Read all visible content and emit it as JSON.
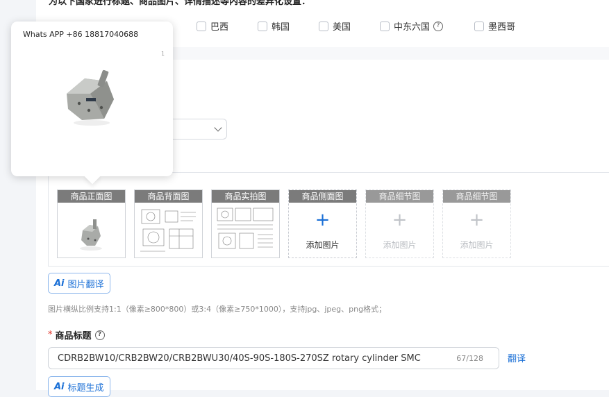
{
  "section": {
    "heading": "为以下国家进行标题、商品图片、详情描述等内容的差异化设置："
  },
  "countries": [
    {
      "label": "巴西"
    },
    {
      "label": "韩国"
    },
    {
      "label": "美国"
    },
    {
      "label": "中东六国"
    },
    {
      "label": "墨西哥"
    }
  ],
  "images": {
    "tiles": [
      {
        "label": "商品正面图"
      },
      {
        "label": "商品背面图"
      },
      {
        "label": "商品实拍图"
      },
      {
        "label": "商品侧面图",
        "add": "添加图片"
      },
      {
        "label": "商品细节图",
        "add": "添加图片"
      },
      {
        "label": "商品细节图",
        "add": "添加图片"
      }
    ],
    "translate_button": "图片翻译",
    "hint": "图片横纵比例支持1:1（像素≥800*800）或3:4（像素≥750*1000），支持jpg、jpeg、png格式；"
  },
  "title_field": {
    "label": "商品标题",
    "value": "CDRB2BW10/CRB2BW20/CRB2BWU30/40S-90S-180S-270SZ rotary cylinder SMC",
    "count": "67/128",
    "translate": "翻译",
    "generate_button": "标题生成"
  },
  "ai_badge": "Ai",
  "preview_popup": {
    "contact": "Whats APP +86 18817040688",
    "mark": "1"
  },
  "colors": {
    "accent": "#1a6fd6",
    "tile_label_bg": "#7b7b7b",
    "required": "#e0362c"
  },
  "icons": {
    "plus": "plus-icon",
    "help": "question-circle-icon",
    "chevron": "chevron-down-icon"
  }
}
